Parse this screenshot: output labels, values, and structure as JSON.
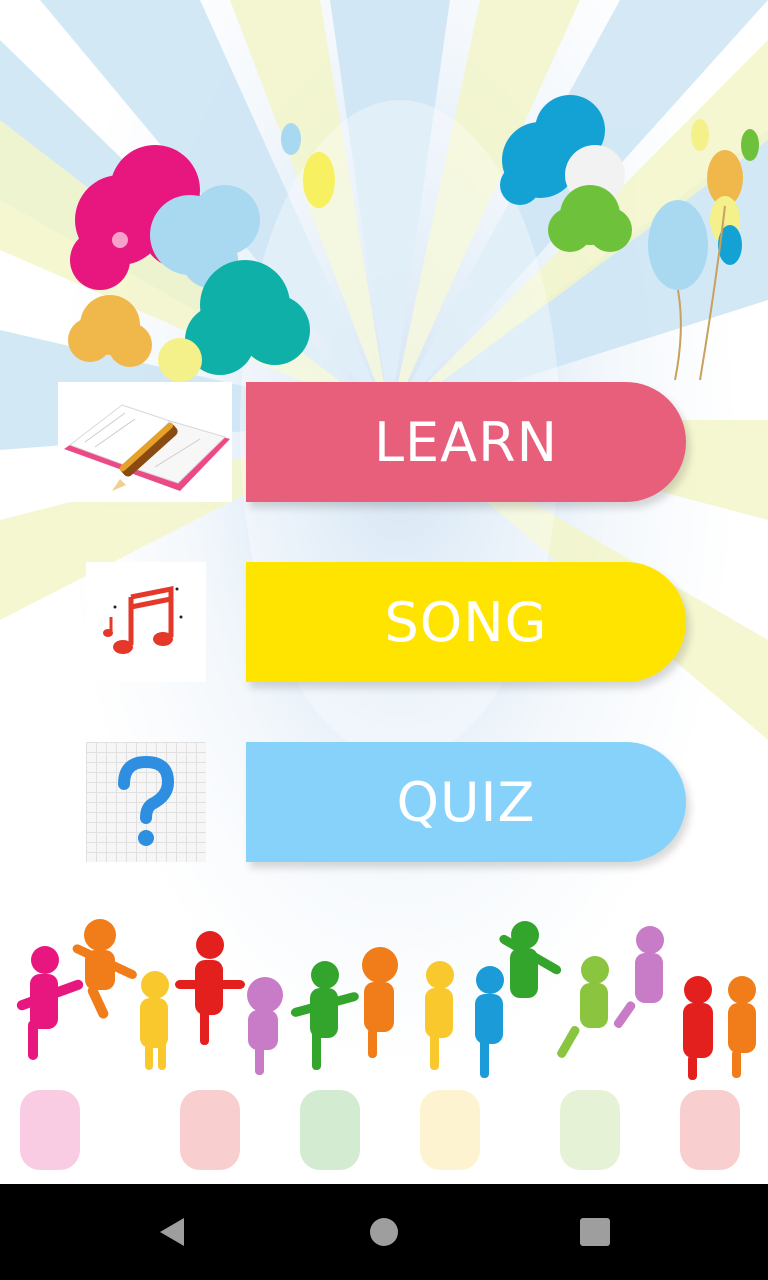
{
  "menu": {
    "learn_label": "LEARN",
    "song_label": "SONG",
    "quiz_label": "QUIZ",
    "learn_color": "#e75f7b",
    "song_color": "#ffe400",
    "quiz_color": "#87d2fb"
  },
  "icons": {
    "learn": "book-pencil-icon",
    "song": "music-notes-icon",
    "quiz": "question-mark-icon"
  },
  "navigation": {
    "back": "back-icon",
    "home": "home-icon",
    "recent": "recent-apps-icon"
  }
}
